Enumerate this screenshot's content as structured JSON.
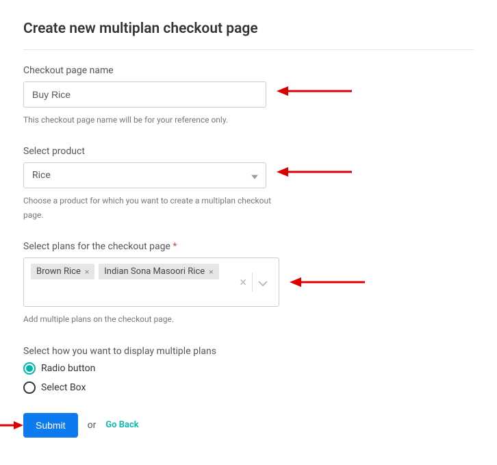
{
  "title": "Create new multiplan checkout page",
  "fields": {
    "name": {
      "label": "Checkout page name",
      "value": "Buy Rice",
      "help": "This checkout page name will be for your reference only."
    },
    "product": {
      "label": "Select product",
      "value": "Rice",
      "help": "Choose a product for which you want to create a multiplan checkout page."
    },
    "plans": {
      "label": "Select plans for the checkout page",
      "required_mark": "*",
      "tags": [
        {
          "label": "Brown Rice"
        },
        {
          "label": "Indian Sona Masoori Rice"
        }
      ],
      "help": "Add multiple plans on the checkout page."
    },
    "display": {
      "label": "Select how you want to display multiple plans",
      "options": [
        {
          "label": "Radio button",
          "selected": true
        },
        {
          "label": "Select Box",
          "selected": false
        }
      ]
    }
  },
  "actions": {
    "submit": "Submit",
    "or": "or",
    "go_back": "Go Back"
  },
  "tag_remove_glyph": "×",
  "clear_glyph": "×"
}
